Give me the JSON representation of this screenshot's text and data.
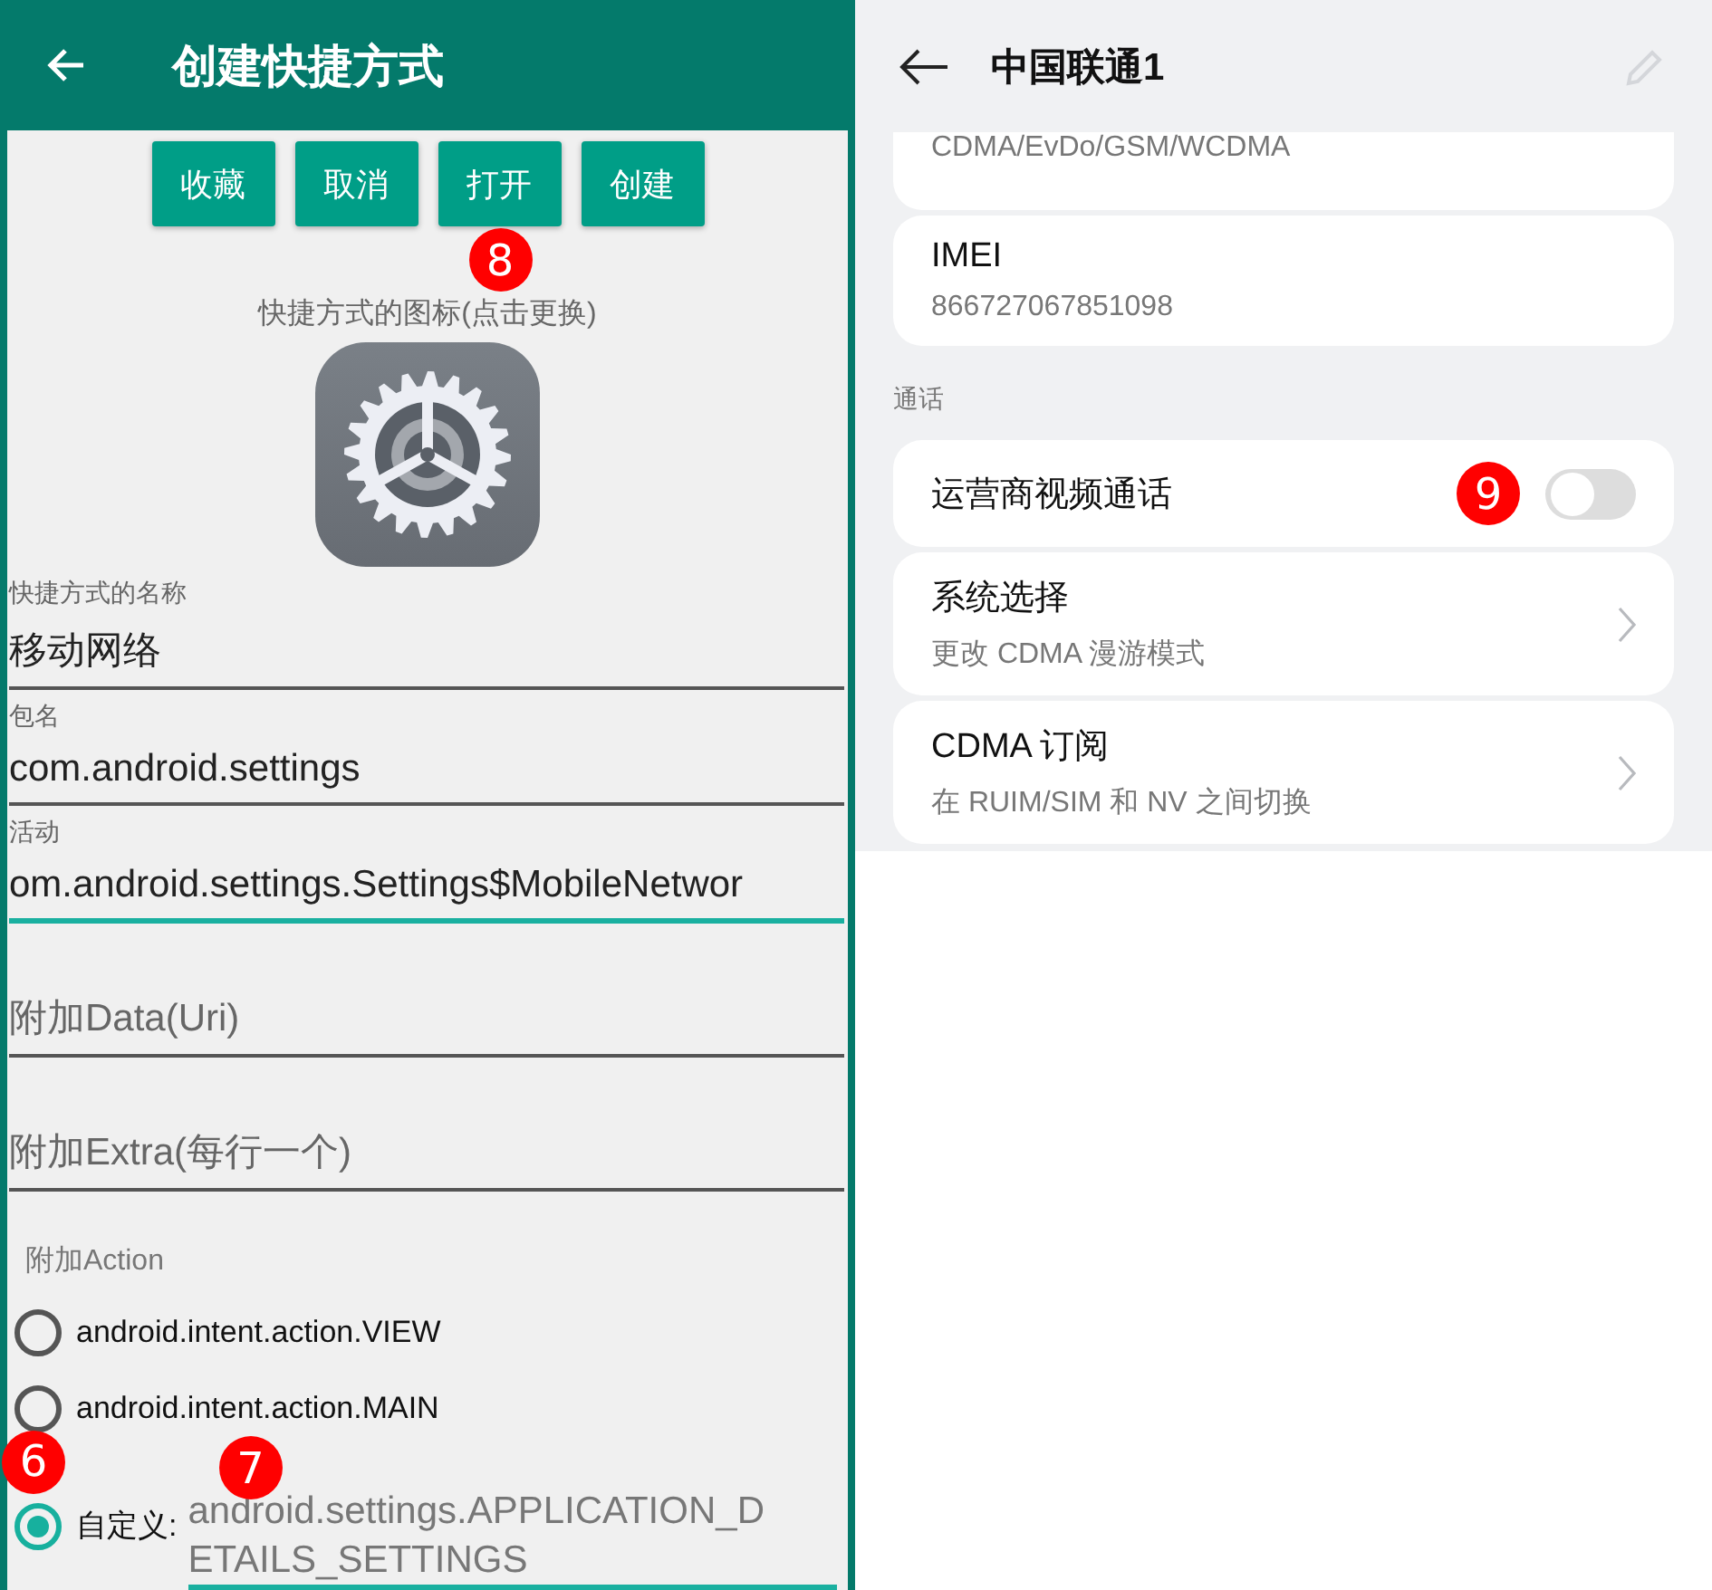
{
  "left": {
    "title": "创建快捷方式",
    "buttons": [
      {
        "label": "收藏"
      },
      {
        "label": "取消"
      },
      {
        "label": "打开",
        "marker": "8"
      },
      {
        "label": "创建"
      }
    ],
    "icon_caption": "快捷方式的图标(点击更换)",
    "fields": [
      {
        "label": "快捷方式的名称",
        "value": "移动网络",
        "focused": false
      },
      {
        "label": "包名",
        "value": "com.android.settings",
        "focused": false
      },
      {
        "label": "活动",
        "value": "om.android.settings.Settings$MobileNetwor",
        "focused": true
      },
      {
        "placeholder": "附加Data(Uri)",
        "focused": false
      },
      {
        "placeholder": "附加Extra(每行一个)",
        "focused": false
      }
    ],
    "action_label": "附加Action",
    "actions": [
      {
        "kind": "preset",
        "label": "android.intent.action.VIEW",
        "selected": false
      },
      {
        "kind": "preset",
        "label": "android.intent.action.MAIN",
        "selected": false
      },
      {
        "kind": "custom",
        "label": "自定义:",
        "value": "android.settings.APPLICATION_DETAILS_SETTINGS",
        "selected": true,
        "marker": "6",
        "value_marker": "7"
      }
    ]
  },
  "right": {
    "title": "中国联通1",
    "rows": [
      {
        "kind": "info",
        "value": "CDMA/EvDo/GSM/WCDMA"
      },
      {
        "kind": "info",
        "title": "IMEI",
        "value": "866727067851098"
      },
      {
        "kind": "section",
        "title": "通话"
      },
      {
        "kind": "toggle",
        "title": "运营商视频通话",
        "on": false,
        "marker": "9"
      },
      {
        "kind": "link",
        "title": "系统选择",
        "value": "更改 CDMA 漫游模式"
      },
      {
        "kind": "link",
        "title": "CDMA 订阅",
        "value": "在 RUIM/SIM 和 NV 之间切换"
      }
    ]
  }
}
